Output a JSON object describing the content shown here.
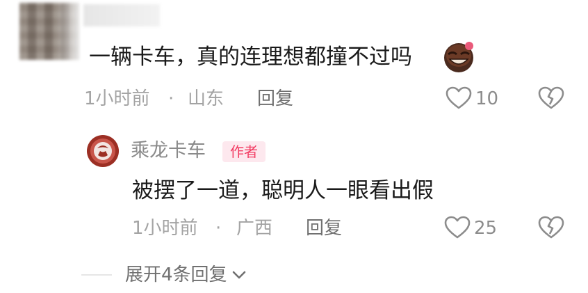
{
  "comment": {
    "text": "一辆卡车，真的连理想都撞不过吗",
    "emoji_icon": "laughing-face-emoji-icon",
    "time": "1小时前",
    "dot": "·",
    "location": "山东",
    "reply_label": "回复",
    "likes": "10"
  },
  "reply": {
    "username": "乘龙卡车",
    "badge": "作者",
    "text": "被摆了一道，聪明人一眼看出假",
    "time": "1小时前",
    "dot": "·",
    "location": "广西",
    "reply_label": "回复",
    "likes": "25"
  },
  "expand": {
    "label": "展开4条回复"
  },
  "colors": {
    "badge_text": "#f23b62",
    "badge_bg": "#fde8ee",
    "meta": "#a3a3a3",
    "main_text": "#1a1a1a"
  }
}
